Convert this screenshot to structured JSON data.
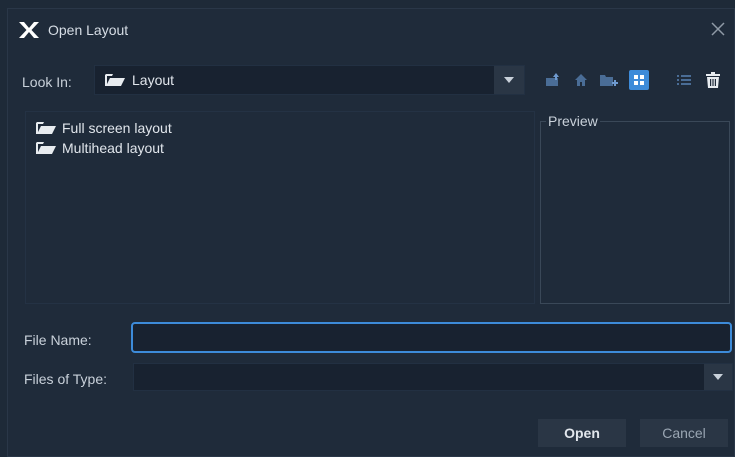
{
  "window": {
    "title": "Open Layout",
    "close_icon": "close-icon",
    "logo_icon": "app-logo"
  },
  "look_in": {
    "label": "Look In:",
    "value": "Layout",
    "icon": "folder-icon"
  },
  "toolbar": {
    "buttons": [
      {
        "name": "up-one-level",
        "icon": "folder-up-icon"
      },
      {
        "name": "home",
        "icon": "home-icon"
      },
      {
        "name": "new-folder",
        "icon": "new-folder-icon"
      },
      {
        "name": "list-view",
        "icon": "grid-view-icon",
        "active": true
      },
      {
        "name": "details-view",
        "icon": "details-view-icon"
      },
      {
        "name": "delete",
        "icon": "trash-icon"
      }
    ]
  },
  "files": [
    {
      "name": "Full screen layout",
      "icon": "folder-icon"
    },
    {
      "name": "Multihead layout",
      "icon": "folder-icon"
    }
  ],
  "preview": {
    "label": "Preview"
  },
  "file_name": {
    "label": "File Name:",
    "value": "",
    "placeholder": ""
  },
  "file_type": {
    "label": "Files of Type:",
    "value": ""
  },
  "buttons": {
    "open": "Open",
    "cancel": "Cancel"
  },
  "colors": {
    "background": "#1f2b3a",
    "accent": "#3d8bd9",
    "field": "#182230",
    "button": "#2a3645"
  }
}
